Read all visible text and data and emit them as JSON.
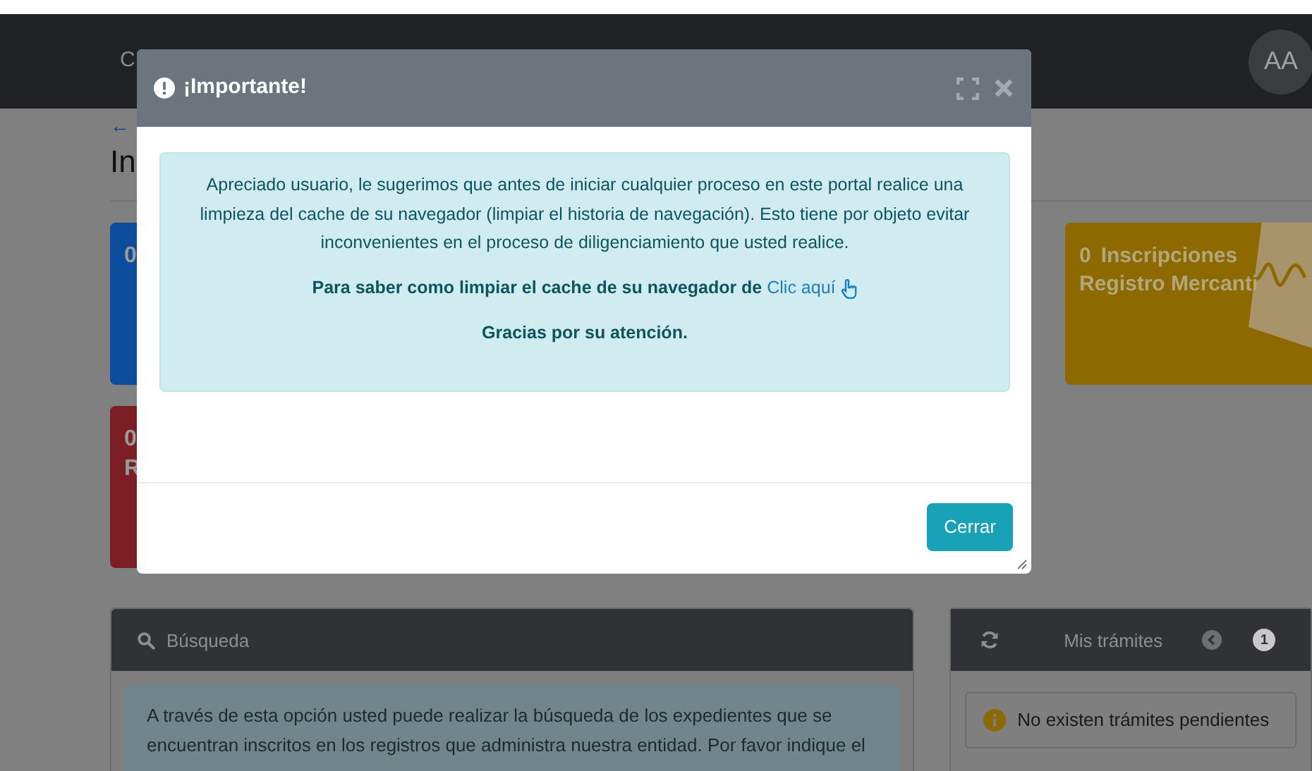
{
  "navbar": {
    "brand": "C",
    "avatar": "AA"
  },
  "page": {
    "back": "←",
    "title": "In"
  },
  "top_cards": [
    {
      "count": "0",
      "color": "#0b4c9c"
    },
    {
      "count": "0",
      "label": "Inscripciones",
      "label2": "Registro Mercanti",
      "color": "#8c6a00"
    }
  ],
  "bottom_cards": [
    {
      "count": "0",
      "label": "R",
      "color": "#7b1f25"
    }
  ],
  "search_panel": {
    "title": "Búsqueda",
    "text": "A través de esta opción usted puede realizar la búsqueda de los expedientes que se encuentran inscritos en los registros que administra nuestra entidad. Por favor indique el"
  },
  "tramites_panel": {
    "title": "Mis trámites",
    "page": "1",
    "message": "No existen trámites pendientes"
  },
  "modal": {
    "title": "¡Importante!",
    "message": "Apreciado usuario, le sugerimos que antes de iniciar cualquier proceso en este portal realice una limpieza del cache de su navegador (limpiar el historia de navegación). Esto tiene por objeto evitar inconvenientes en el proceso de diligenciamiento que usted realice.",
    "instruction": "Para saber como limpiar el cache de su navegador de",
    "link": "Clic aquí",
    "thanks": "Gracias por su atención.",
    "button": "Cerrar"
  }
}
